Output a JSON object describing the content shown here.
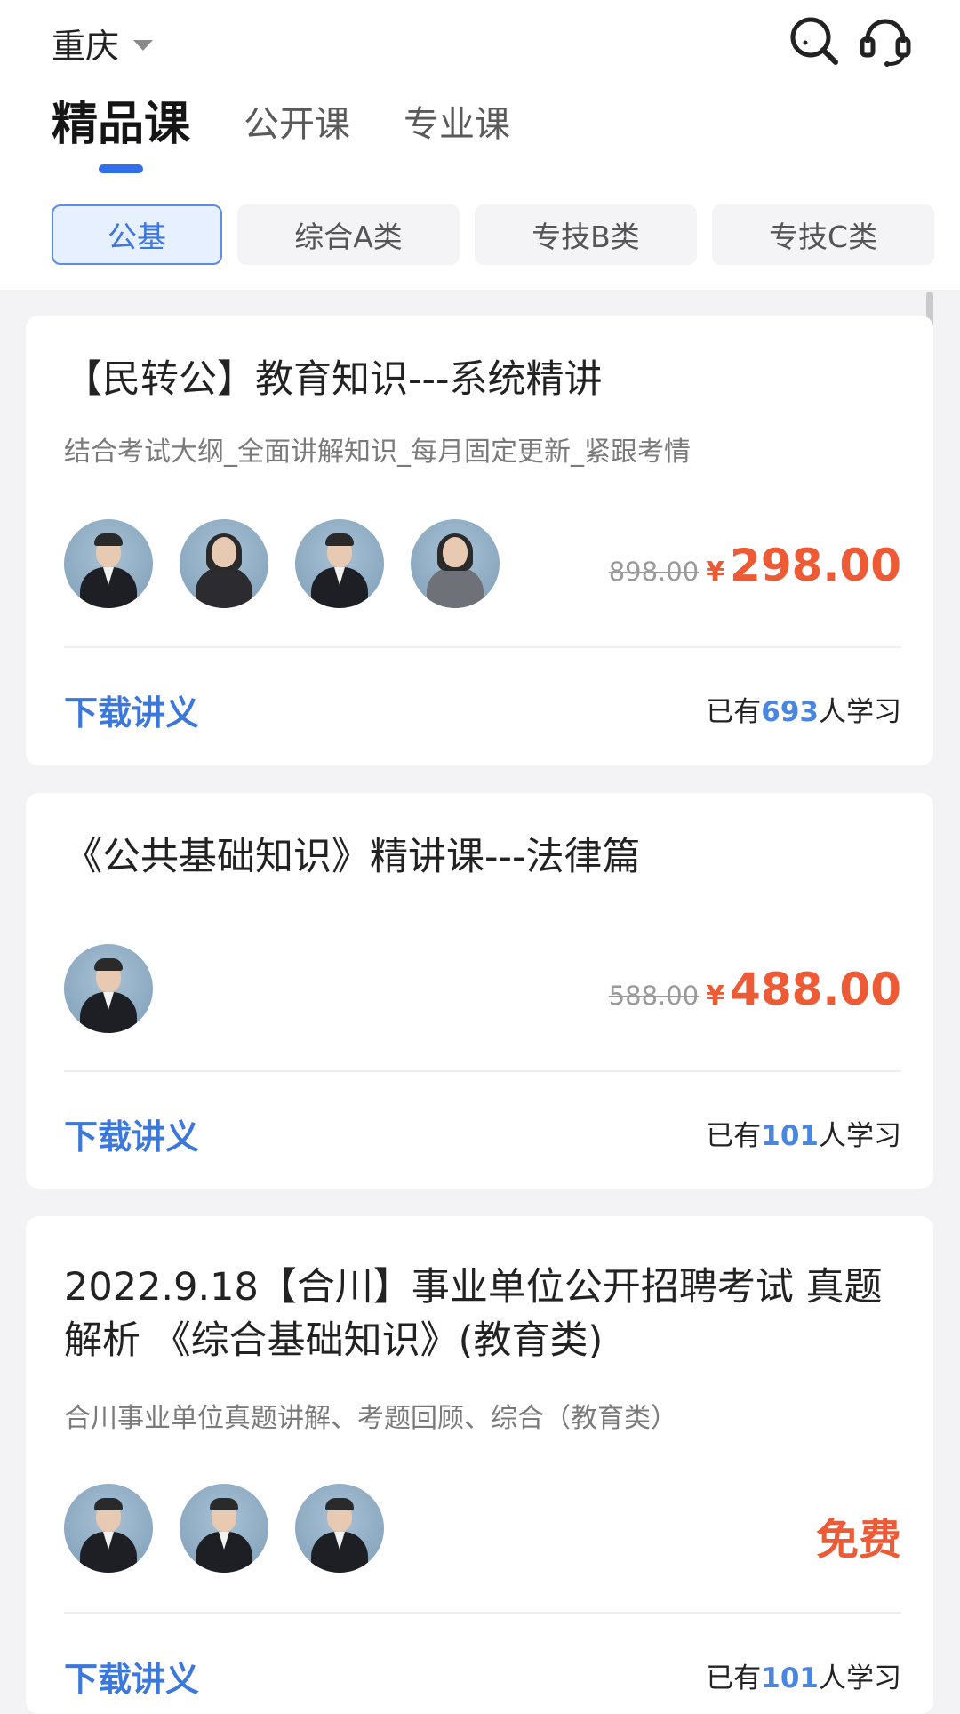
{
  "header": {
    "city": "重庆",
    "icons": {
      "search": "search-icon",
      "service": "headset-icon"
    }
  },
  "tabs": [
    {
      "label": "精品课",
      "active": true
    },
    {
      "label": "公开课",
      "active": false
    },
    {
      "label": "专业课",
      "active": false
    }
  ],
  "chips": [
    {
      "label": "公基",
      "active": true
    },
    {
      "label": "综合A类",
      "active": false
    },
    {
      "label": "专技B类",
      "active": false
    },
    {
      "label": "专技C类",
      "active": false
    }
  ],
  "courses": [
    {
      "title": "【民转公】教育知识---系统精讲",
      "desc": "结合考试大纲_全面讲解知识_每月固定更新_紧跟考情",
      "original_price": "898.00",
      "currency": "¥",
      "price": "298.00",
      "download_label": "下载讲义",
      "learners_prefix": "已有",
      "learners_count": "693",
      "learners_suffix": "人学习"
    },
    {
      "title": "《公共基础知识》精讲课---法律篇",
      "original_price": "588.00",
      "currency": "¥",
      "price": "488.00",
      "download_label": "下载讲义",
      "learners_prefix": "已有",
      "learners_count": "101",
      "learners_suffix": "人学习"
    },
    {
      "title": "2022.9.18【合川】事业单位公开招聘考试 真题解析 《综合基础知识》(教育类)",
      "desc": "合川事业单位真题讲解、考题回顾、综合（教育类）",
      "free_label": "免费",
      "download_label": "下载讲义",
      "learners_prefix": "已有",
      "learners_count": "101",
      "learners_suffix": "人学习"
    }
  ],
  "colors": {
    "accent_blue": "#2f6fe8",
    "price_red": "#ec5b35",
    "link_blue": "#3c78dc"
  }
}
